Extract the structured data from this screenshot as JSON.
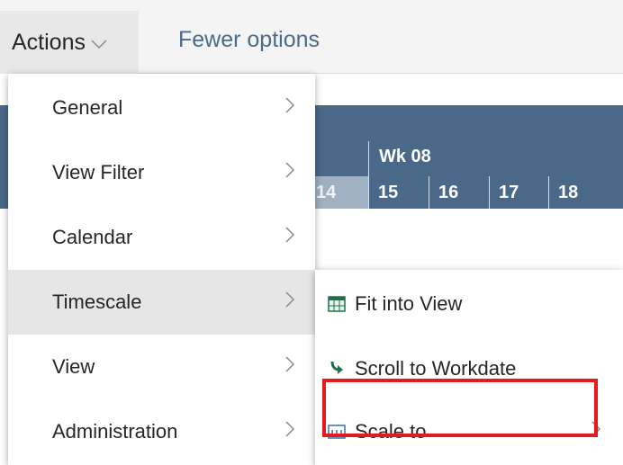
{
  "toolbar": {
    "actions_label": "Actions",
    "fewer_options_label": "Fewer options"
  },
  "gantt": {
    "week_label": "Wk 08",
    "days": [
      "14",
      "15",
      "16",
      "17",
      "18"
    ]
  },
  "menu": {
    "items": [
      {
        "label": "General"
      },
      {
        "label": "View Filter"
      },
      {
        "label": "Calendar"
      },
      {
        "label": "Timescale"
      },
      {
        "label": "View"
      },
      {
        "label": "Administration"
      }
    ],
    "active_item": "Timescale"
  },
  "submenu": {
    "items": [
      {
        "label": "Fit into View",
        "icon": "fit-into-view-icon"
      },
      {
        "label": "Scroll to Workdate",
        "icon": "scroll-to-workdate-icon"
      },
      {
        "label": "Scale to",
        "icon": "scale-to-icon"
      }
    ]
  },
  "colors": {
    "header_blue": "#4a6989",
    "highlight_red": "#e8191c",
    "link_blue": "#4a6b8a"
  }
}
